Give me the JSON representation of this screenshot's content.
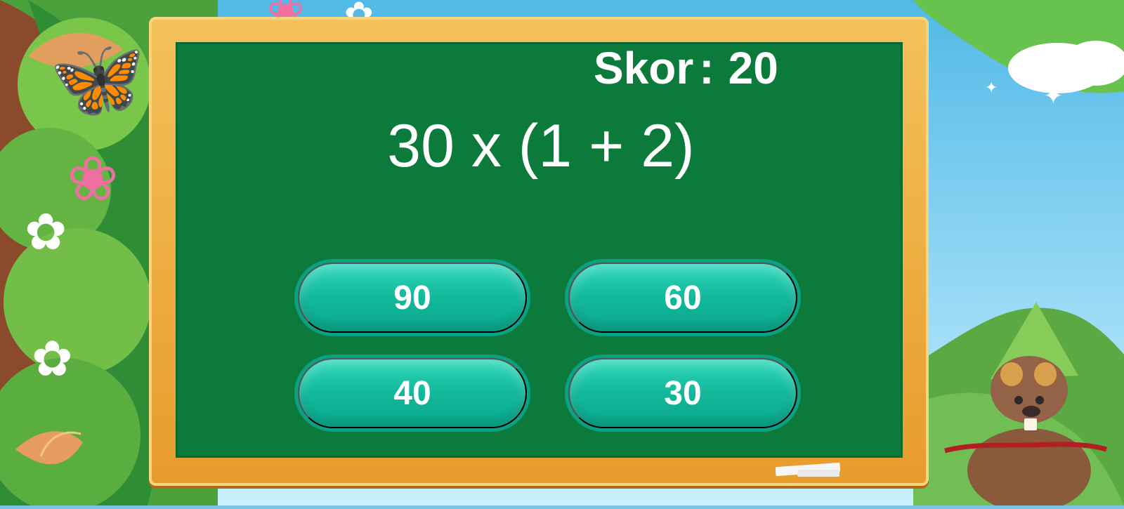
{
  "score": {
    "label": "Skor",
    "separator": ":",
    "value": "20"
  },
  "question": "30 x (1 + 2)",
  "answers": [
    "90",
    "60",
    "40",
    "30"
  ],
  "colors": {
    "board": "#0c7a3b",
    "frame": "#f0b340",
    "button": "#14b99b",
    "text": "#ffffff"
  }
}
